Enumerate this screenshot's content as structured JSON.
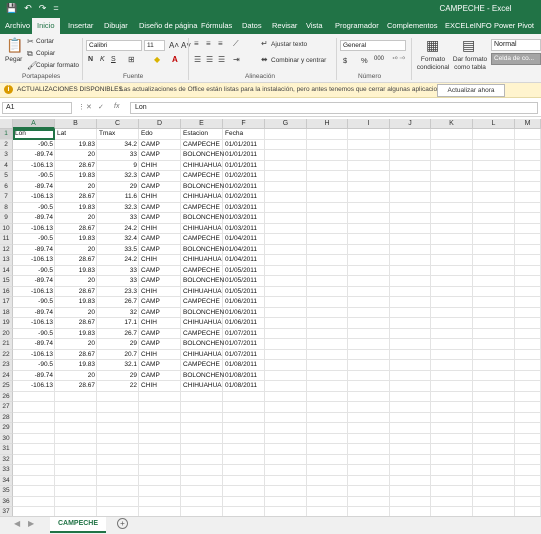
{
  "window": {
    "title": "CAMPECHE - Excel"
  },
  "qat": {
    "save": "💾",
    "undo": "↶",
    "redo": "↷",
    "more": "="
  },
  "tabs": [
    "Archivo",
    "Inicio",
    "Insertar",
    "Dibujar",
    "Diseño de página",
    "Fórmulas",
    "Datos",
    "Revisar",
    "Vista",
    "Programador",
    "Complementos",
    "EXCELeINFO",
    "Power Pivot"
  ],
  "ribbon": {
    "clipboard": {
      "paste": "Pegar",
      "cut": "Cortar",
      "copy": "Copiar",
      "format_painter": "Copiar formato",
      "group": "Portapapeles"
    },
    "font": {
      "name": "Calibri",
      "size": "11",
      "bold": "N",
      "italic": "K",
      "underline": "S",
      "group": "Fuente"
    },
    "alignment": {
      "wrap": "Ajustar texto",
      "merge": "Combinar y centrar",
      "group": "Alineación"
    },
    "number": {
      "format": "General",
      "currency": "$",
      "percent": "%",
      "thousands": "000",
      "group": "Número"
    },
    "styles": {
      "conditional": "Formato condicional",
      "as_table": "Dar formato como tabla",
      "normal": "Normal",
      "bad": "Celda de co..."
    }
  },
  "message": {
    "title": "ACTUALIZACIONES DISPONIBLES",
    "text": "Las actualizaciones de Office están listas para la instalación, pero antes tenemos que cerrar algunas aplicaciones.",
    "button": "Actualizar ahora"
  },
  "formula_bar": {
    "name_box": "A1",
    "fx": "fx",
    "value": "Lon"
  },
  "columns": [
    "A",
    "B",
    "C",
    "D",
    "E",
    "F",
    "G",
    "H",
    "I",
    "J",
    "K",
    "L",
    "M"
  ],
  "headers": [
    "Lon",
    "Lat",
    "Tmax",
    "Edo",
    "Estacion",
    "Fecha"
  ],
  "rows": [
    [
      "-90.5",
      "19.83",
      "34.2",
      "CAMP",
      "CAMPECHE",
      "01/01/2011"
    ],
    [
      "-89.74",
      "20",
      "33",
      "CAMP",
      "BOLONCHEN",
      "01/01/2011"
    ],
    [
      "-106.13",
      "28.67",
      "9",
      "CHIH",
      "CHIHUAHUA",
      "01/01/2011"
    ],
    [
      "-90.5",
      "19.83",
      "32.3",
      "CAMP",
      "CAMPECHE",
      "01/02/2011"
    ],
    [
      "-89.74",
      "20",
      "29",
      "CAMP",
      "BOLONCHEN",
      "01/02/2011"
    ],
    [
      "-106.13",
      "28.67",
      "11.6",
      "CHIH",
      "CHIHUAHUA",
      "01/02/2011"
    ],
    [
      "-90.5",
      "19.83",
      "32.3",
      "CAMP",
      "CAMPECHE",
      "01/03/2011"
    ],
    [
      "-89.74",
      "20",
      "33",
      "CAMP",
      "BOLONCHEN",
      "01/03/2011"
    ],
    [
      "-106.13",
      "28.67",
      "24.2",
      "CHIH",
      "CHIHUAHUA",
      "01/03/2011"
    ],
    [
      "-90.5",
      "19.83",
      "32.4",
      "CAMP",
      "CAMPECHE",
      "01/04/2011"
    ],
    [
      "-89.74",
      "20",
      "33.5",
      "CAMP",
      "BOLONCHEN",
      "01/04/2011"
    ],
    [
      "-106.13",
      "28.67",
      "24.2",
      "CHIH",
      "CHIHUAHUA",
      "01/04/2011"
    ],
    [
      "-90.5",
      "19.83",
      "33",
      "CAMP",
      "CAMPECHE",
      "01/05/2011"
    ],
    [
      "-89.74",
      "20",
      "33",
      "CAMP",
      "BOLONCHEN",
      "01/05/2011"
    ],
    [
      "-106.13",
      "28.67",
      "23.3",
      "CHIH",
      "CHIHUAHUA",
      "01/05/2011"
    ],
    [
      "-90.5",
      "19.83",
      "26.7",
      "CAMP",
      "CAMPECHE",
      "01/06/2011"
    ],
    [
      "-89.74",
      "20",
      "32",
      "CAMP",
      "BOLONCHEN",
      "01/06/2011"
    ],
    [
      "-106.13",
      "28.67",
      "17.1",
      "CHIH",
      "CHIHUAHUA",
      "01/06/2011"
    ],
    [
      "-90.5",
      "19.83",
      "26.7",
      "CAMP",
      "CAMPECHE",
      "01/07/2011"
    ],
    [
      "-89.74",
      "20",
      "29",
      "CAMP",
      "BOLONCHEN",
      "01/07/2011"
    ],
    [
      "-106.13",
      "28.67",
      "20.7",
      "CHIH",
      "CHIHUAHUA",
      "01/07/2011"
    ],
    [
      "-90.5",
      "19.83",
      "32.1",
      "CAMP",
      "CAMPECHE",
      "01/08/2011"
    ],
    [
      "-89.74",
      "20",
      "29",
      "CAMP",
      "BOLONCHEN",
      "01/08/2011"
    ],
    [
      "-106.13",
      "28.67",
      "22",
      "CHIH",
      "CHIHUAHUA",
      "01/08/2011"
    ]
  ],
  "row_numbers": [
    "1",
    "2",
    "3",
    "4",
    "5",
    "6",
    "7",
    "8",
    "9",
    "10",
    "11",
    "12",
    "13",
    "14",
    "15",
    "16",
    "17",
    "18",
    "19",
    "20",
    "21",
    "22",
    "23",
    "24",
    "25",
    "26",
    "27",
    "28",
    "29",
    "30",
    "31",
    "32",
    "33",
    "34",
    "35",
    "36",
    "37"
  ],
  "sheet": {
    "name": "CAMPECHE",
    "add": "+",
    "prev": "◀",
    "next": "▶"
  },
  "colors": {
    "accent": "#217346",
    "message_bg": "#fff4ce"
  }
}
